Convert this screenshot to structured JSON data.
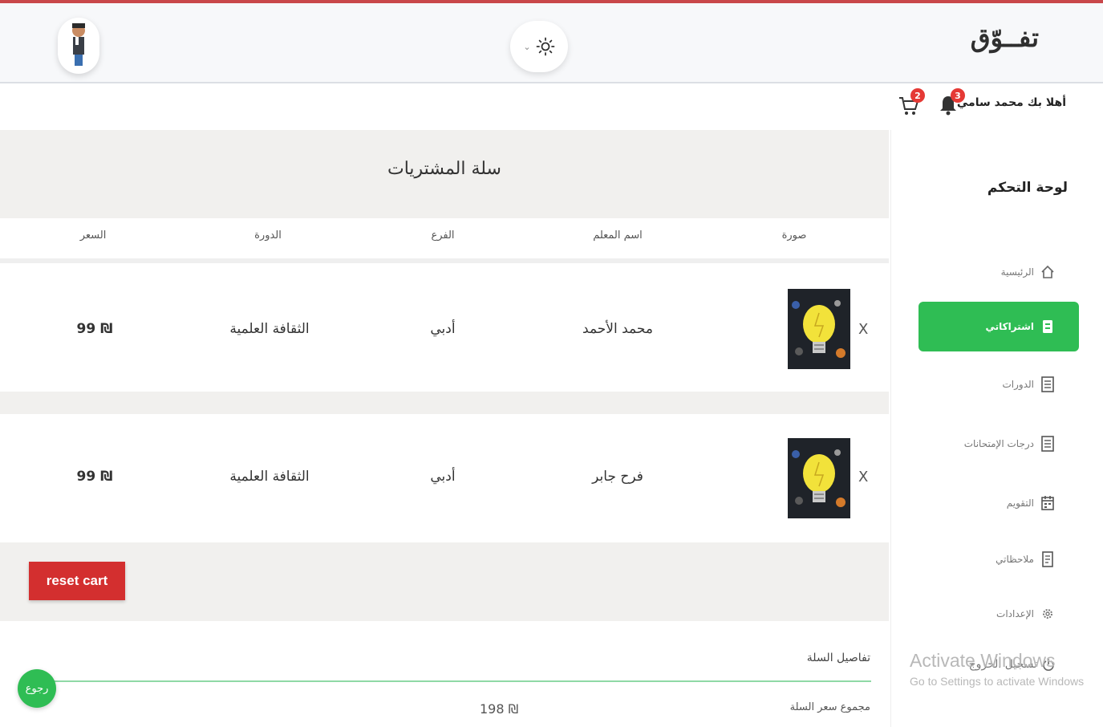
{
  "header": {
    "logo": "تفــوّق",
    "theme_chevron": "⌄"
  },
  "subheader": {
    "welcome": "أهلا بك محمد سامي",
    "notifications_count": "3",
    "cart_count": "2"
  },
  "sidebar": {
    "title": "لوحة التحكم",
    "items": [
      {
        "label": "الرئيسية",
        "icon": "home-icon",
        "active": false
      },
      {
        "label": "اشتراكاتي",
        "icon": "badge-icon",
        "active": true
      },
      {
        "label": "الدورات",
        "icon": "list-icon",
        "active": false
      },
      {
        "label": "درجات الإمتحانات",
        "icon": "list-icon",
        "active": false
      },
      {
        "label": "التقويم",
        "icon": "calendar-icon",
        "active": false
      },
      {
        "label": "ملاحظاتي",
        "icon": "note-icon",
        "active": false
      },
      {
        "label": "الإعدادات",
        "icon": "gear-icon",
        "active": false
      }
    ],
    "logout": "تسجيل الخروج"
  },
  "cart": {
    "title": "سلة المشتريات",
    "columns": [
      "صورة",
      "اسم المعلم",
      "الفرع",
      "الدورة",
      "السعر"
    ],
    "rows": [
      {
        "teacher": "محمد الأحمد",
        "branch": "أدبي",
        "course": "الثقافة العلمية",
        "price": "99 ₪",
        "remove": "X"
      },
      {
        "teacher": "فرح جابر",
        "branch": "أدبي",
        "course": "الثقافة العلمية",
        "price": "99 ₪",
        "remove": "X"
      }
    ],
    "reset_label": "reset cart",
    "details_title": "تفاصيل السلة",
    "total_label": "مجموع سعر السلة",
    "total_value": "198 ₪",
    "back_label": "رجوع"
  },
  "watermark": {
    "line1": "Activate Windows",
    "line2": "Go to Settings to activate Windows"
  },
  "colors": {
    "accent_green": "#2fbd54",
    "danger_red": "#d32f2f",
    "badge_red": "#e53935"
  }
}
